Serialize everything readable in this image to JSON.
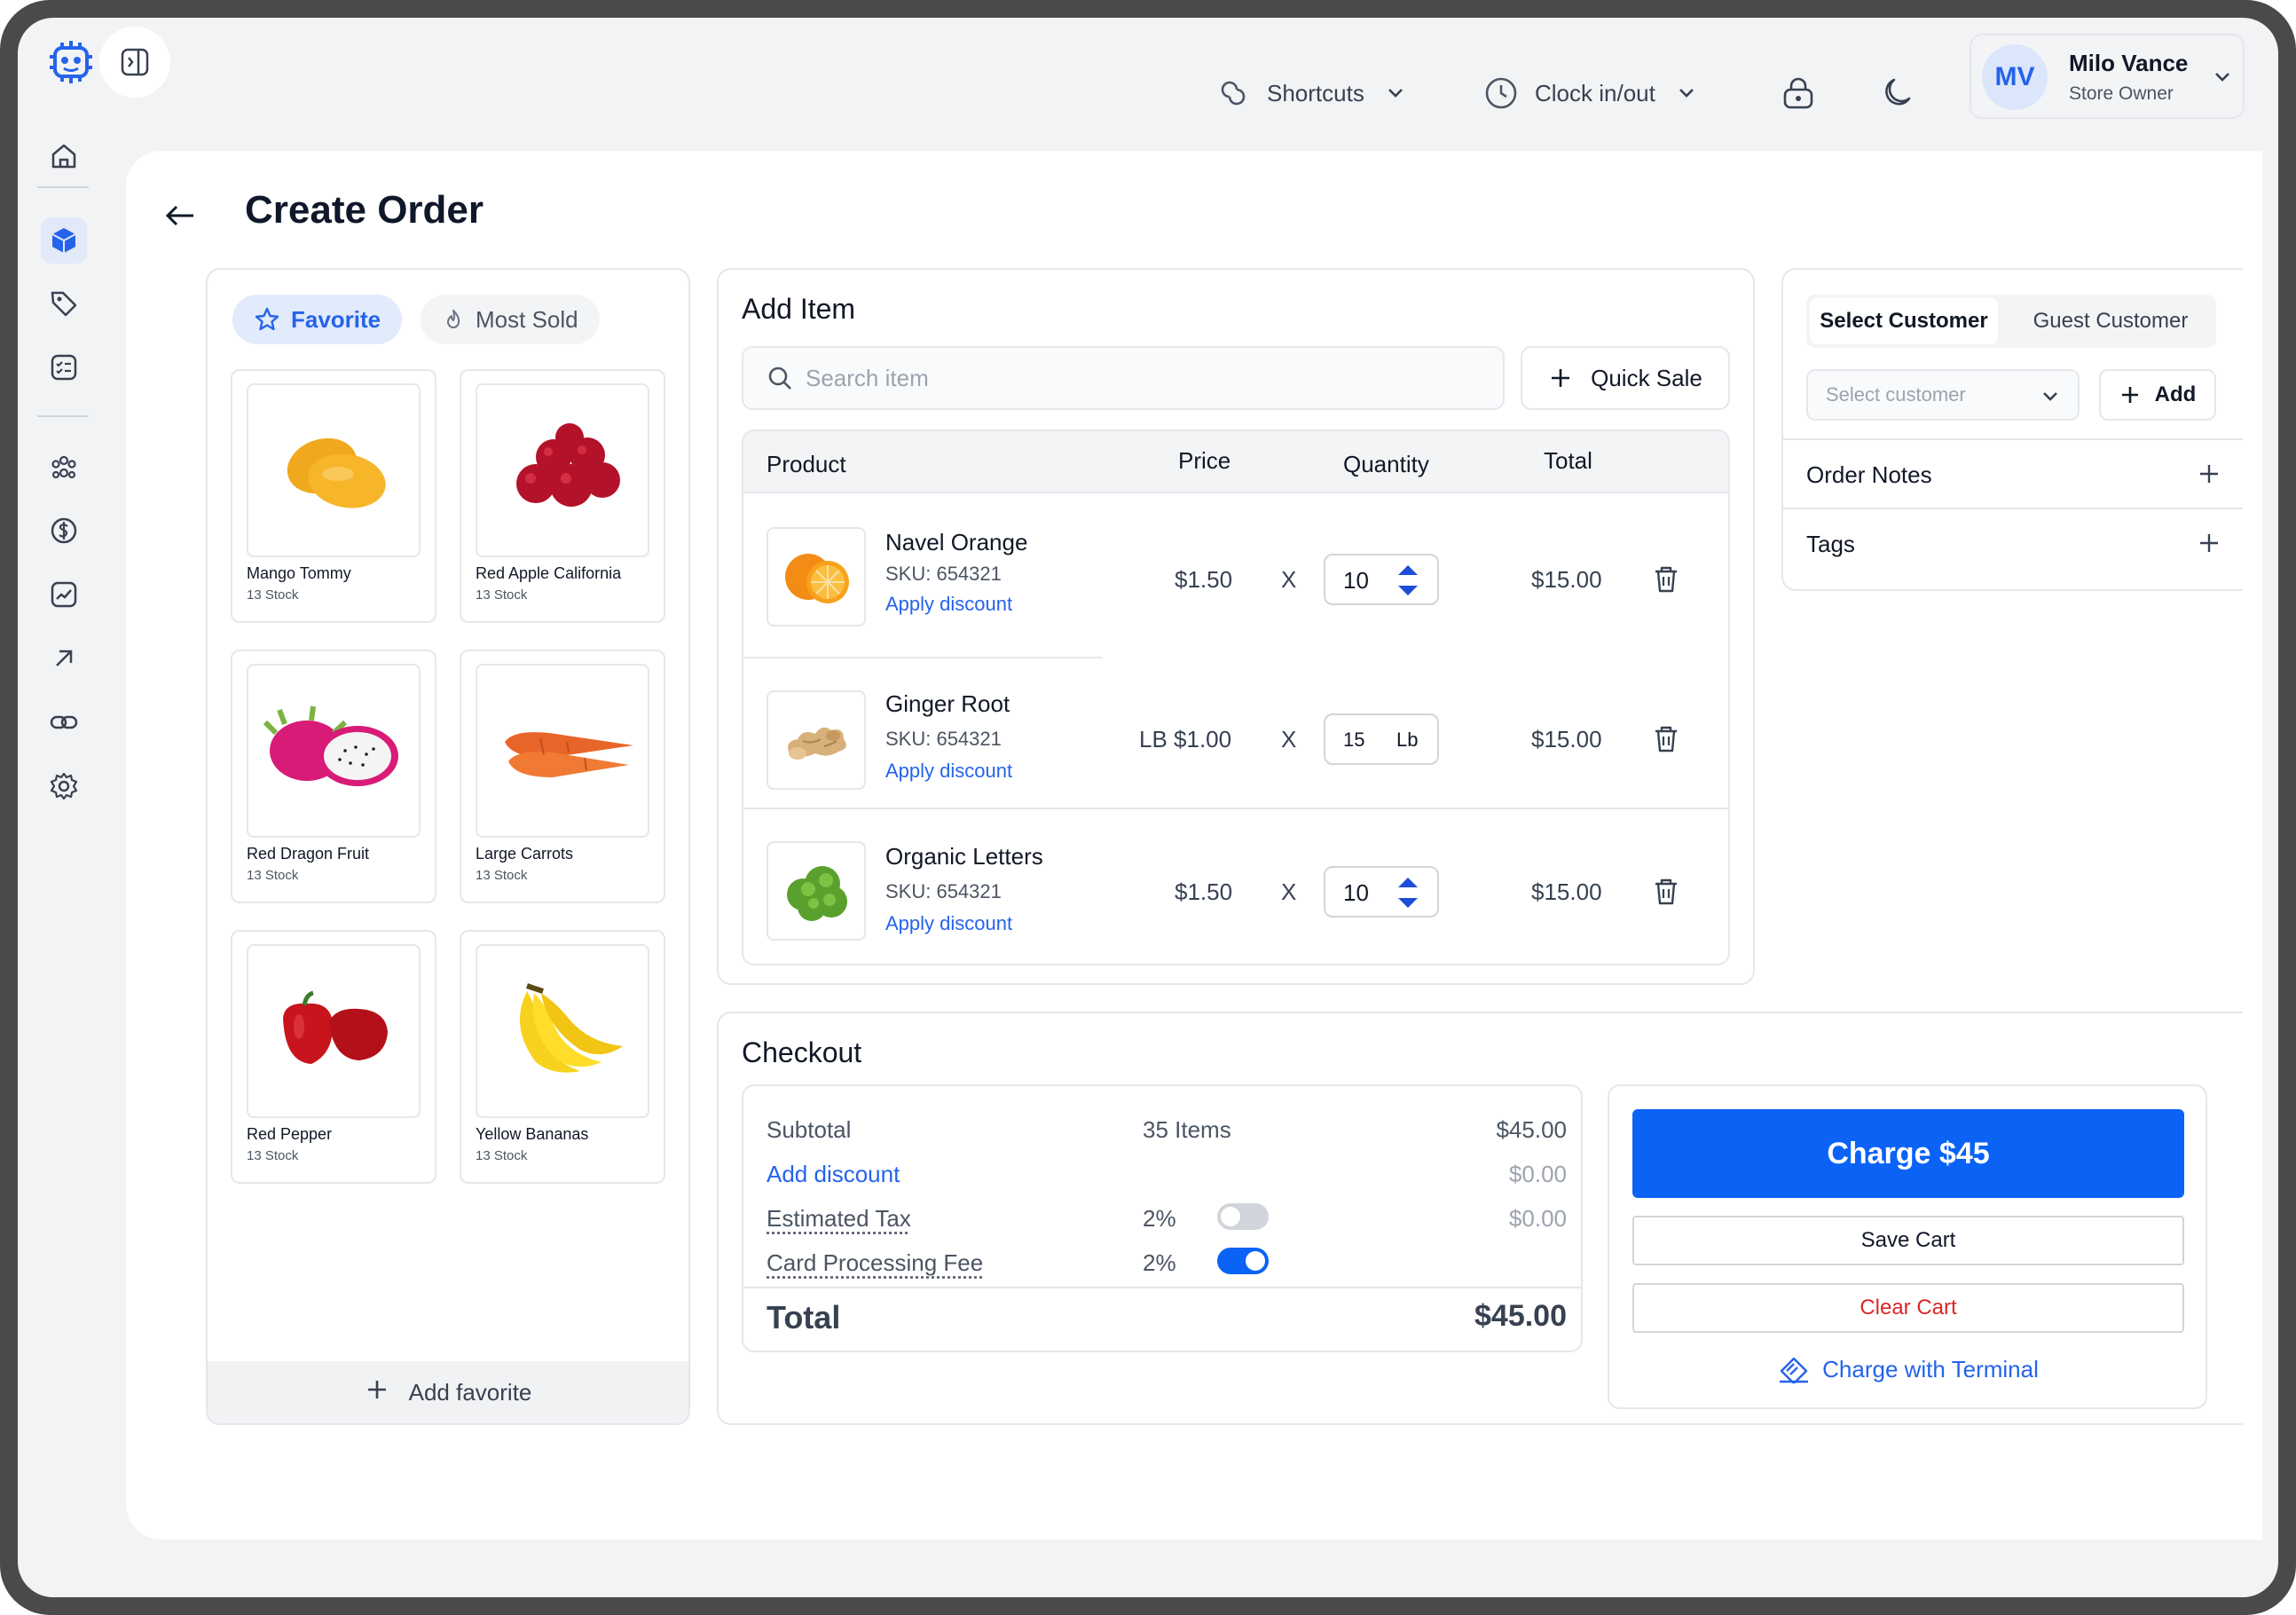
{
  "colors": {
    "accent": "#0b63f6",
    "link": "#2563eb",
    "danger": "#dc2626"
  },
  "topbar": {
    "shortcuts": "Shortcuts",
    "clock": "Clock in/out",
    "user": {
      "initials": "MV",
      "name": "Milo Vance",
      "role": "Store Owner"
    }
  },
  "page": {
    "title": "Create Order"
  },
  "favorites": {
    "tabs": {
      "favorite": "Favorite",
      "most_sold": "Most Sold"
    },
    "items": [
      {
        "name": "Mango Tommy",
        "stock": "13 Stock",
        "icon": "mango-image"
      },
      {
        "name": "Red Apple California",
        "stock": "13 Stock",
        "icon": "apple-image"
      },
      {
        "name": "Red Dragon Fruit",
        "stock": "13 Stock",
        "icon": "dragon-fruit-image"
      },
      {
        "name": "Large Carrots",
        "stock": "13 Stock",
        "icon": "carrot-image"
      },
      {
        "name": "Red Pepper",
        "stock": "13 Stock",
        "icon": "pepper-image"
      },
      {
        "name": "Yellow Bananas",
        "stock": "13 Stock",
        "icon": "banana-image"
      }
    ],
    "add_label": "Add favorite"
  },
  "add_item": {
    "title": "Add Item",
    "search_placeholder": "Search item",
    "quick_sale": "Quick Sale",
    "columns": {
      "product": "Product",
      "price": "Price",
      "quantity": "Quantity",
      "total": "Total"
    },
    "rows": [
      {
        "name": "Navel Orange",
        "sku": "SKU: 654321",
        "discount": "Apply discount",
        "price": "$1.50",
        "x": "X",
        "qty": "10",
        "unit": "",
        "total": "$15.00"
      },
      {
        "name": "Ginger Root",
        "sku": "SKU: 654321",
        "discount": "Apply discount",
        "price": "LB $1.00",
        "x": "X",
        "qty": "15",
        "unit": "Lb",
        "total": "$15.00"
      },
      {
        "name": "Organic Letters",
        "sku": "SKU: 654321",
        "discount": "Apply discount",
        "price": "$1.50",
        "x": "X",
        "qty": "10",
        "unit": "",
        "total": "$15.00"
      }
    ]
  },
  "customer": {
    "tabs": {
      "select": "Select Customer",
      "guest": "Guest Customer"
    },
    "select_placeholder": "Select customer",
    "add": "Add",
    "order_notes": "Order Notes",
    "tags": "Tags"
  },
  "checkout": {
    "title": "Checkout",
    "subtotal_label": "Subtotal",
    "subtotal_items": "35 Items",
    "subtotal_value": "$45.00",
    "add_discount": "Add discount",
    "discount_value": "$0.00",
    "tax_label": "Estimated Tax",
    "tax_pct": "2%",
    "tax_value": "$0.00",
    "tax_enabled": false,
    "fee_label": "Card Processing Fee",
    "fee_pct": "2%",
    "fee_enabled": true,
    "total_label": "Total",
    "total_value": "$45.00",
    "charge": "Charge $45",
    "save_cart": "Save Cart",
    "clear_cart": "Clear Cart",
    "terminal": "Charge with Terminal"
  }
}
